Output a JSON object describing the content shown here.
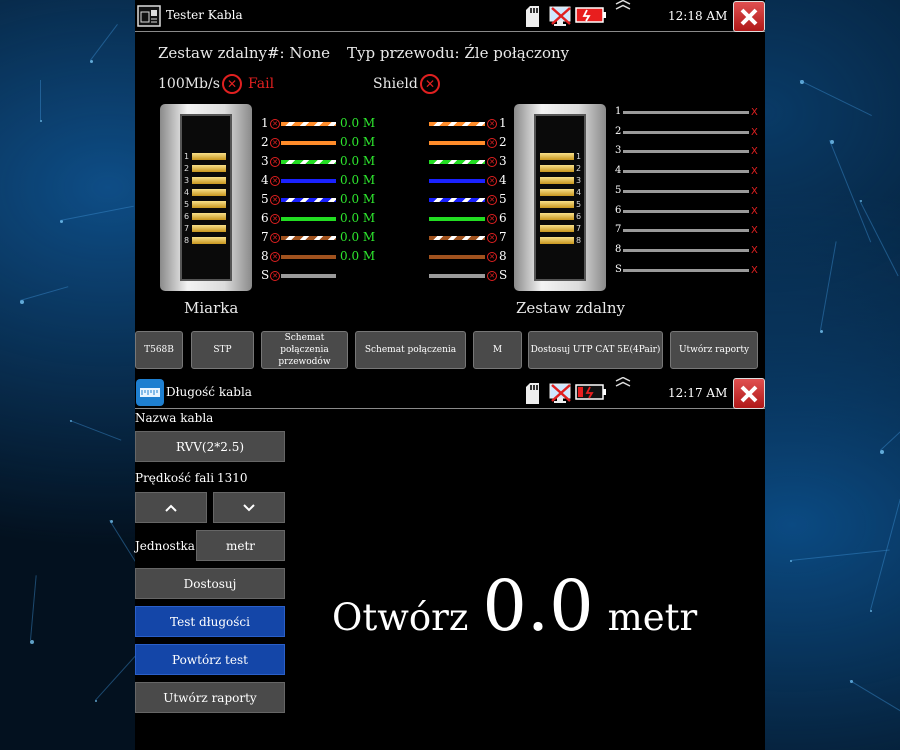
{
  "tester": {
    "title": "Tester Kabla",
    "time": "12:18 AM",
    "remote_id_label": "Zestaw zdalny#: None",
    "cable_type_label": "Typ przewodu: Źle połączony",
    "speed_label": "100Mb/s",
    "speed_status": "Fail",
    "shield_label": "Shield",
    "left_connector_label": "Miarka",
    "right_connector_label": "Zestaw zdalny",
    "connector_pins": [
      "1",
      "2",
      "3",
      "4",
      "5",
      "6",
      "7",
      "8"
    ],
    "left_wires": [
      {
        "num": "1",
        "value": "0.0 M",
        "color": "#ff8c2a",
        "striped": true
      },
      {
        "num": "2",
        "value": "0.0 M",
        "color": "#ff8c2a",
        "striped": false
      },
      {
        "num": "3",
        "value": "0.0 M",
        "color": "#22dd22",
        "striped": true
      },
      {
        "num": "4",
        "value": "0.0 M",
        "color": "#1a22ff",
        "striped": false
      },
      {
        "num": "5",
        "value": "0.0 M",
        "color": "#1a22ff",
        "striped": true
      },
      {
        "num": "6",
        "value": "0.0 M",
        "color": "#22dd22",
        "striped": false
      },
      {
        "num": "7",
        "value": "0.0 M",
        "color": "#a0521e",
        "striped": true
      },
      {
        "num": "8",
        "value": "0.0 M",
        "color": "#a0521e",
        "striped": false
      },
      {
        "num": "S",
        "value": "",
        "color": "#9a9a9a",
        "striped": false
      }
    ],
    "right_pins": [
      "1",
      "2",
      "3",
      "4",
      "5",
      "6",
      "7",
      "8",
      "S"
    ],
    "right_marker": "X",
    "buttons": [
      "T568B",
      "STP",
      "Schemat połączenia przewodów",
      "Schemat połączenia",
      "M",
      "Dostosuj UTP CAT 5E(4Pair)",
      "Utwórz raporty"
    ]
  },
  "length": {
    "title": "Długość kabla",
    "time": "12:17 AM",
    "cable_name_label": "Nazwa kabla",
    "cable_name_value": "RVV(2*2.5)",
    "wave_speed_label": "Prędkość fali",
    "wave_speed_value": "1310",
    "up_button": "up",
    "down_button": "down",
    "unit_label": "Jednostka",
    "unit_value": "metr",
    "customize_button": "Dostosuj",
    "test_length_button": "Test długości",
    "repeat_test_button": "Powtórz test",
    "report_button": "Utwórz raporty",
    "result_status": "Otwórz",
    "result_value": "0.0",
    "result_unit": "metr"
  },
  "colors": {
    "pass": "#2ee62e",
    "fail": "#e02020",
    "primary_button": "#1446a8",
    "button": "#4a4a4a"
  },
  "icons": [
    "tester-app-icon",
    "sd-card-icon",
    "network-monitor-icon",
    "battery-icon",
    "chevron-up-icon",
    "close-icon",
    "length-app-icon",
    "chevron-down-icon"
  ]
}
